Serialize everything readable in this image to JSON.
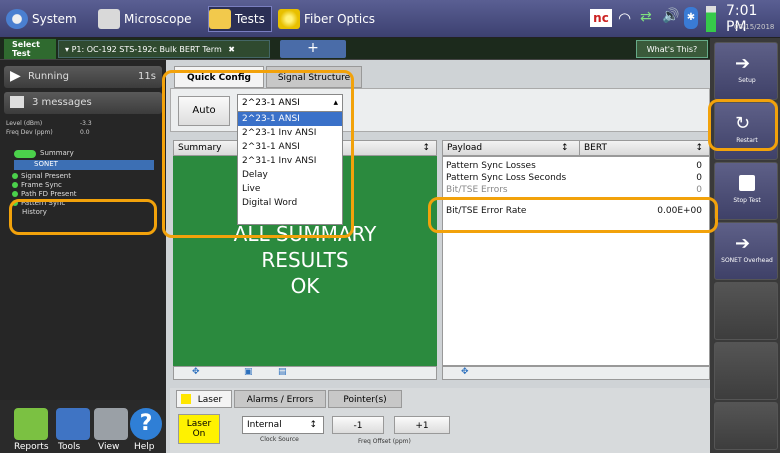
{
  "topbar": {
    "system": "System",
    "microscope": "Microscope",
    "tests": "Tests",
    "fiber_optics": "Fiber Optics",
    "nc_badge": "nc",
    "time": "7:01 PM",
    "date": "06/15/2018"
  },
  "testbar": {
    "select_test": "Select Test",
    "tab_name": "P1: OC-192 STS-192c Bulk BERT Term",
    "add_tab": "+",
    "whats_this": "What's This?"
  },
  "left": {
    "running": "Running",
    "elapsed": "11s",
    "messages": "3 messages",
    "level_label": "Level (dBm)",
    "level_value": "-3.3",
    "freq_label": "Freq Dev (ppm)",
    "freq_value": "0.0",
    "tree": {
      "summary": "Summary",
      "sonet": "SONET",
      "signal_present": "Signal Present",
      "frame_sync": "Frame Sync",
      "path_fd_present": "Path FD Present",
      "pattern_sync": "Pattern Sync",
      "history": "History"
    }
  },
  "bottom_nav": {
    "reports": "Reports",
    "tools": "Tools",
    "view": "View",
    "help": "Help"
  },
  "config": {
    "tab_quick": "Quick Config",
    "tab_signal": "Signal Structure",
    "auto": "Auto",
    "pattern_selected": "2^23-1 ANSI",
    "pattern_options": [
      "2^23-1 ANSI",
      "2^23-1 Inv ANSI",
      "2^31-1 ANSI",
      "2^31-1 Inv ANSI",
      "Delay",
      "Live",
      "Digital Word"
    ]
  },
  "summary": {
    "header": "Summary",
    "line1": "ALL SUMMARY",
    "line2": "RESULTS",
    "line3": "OK"
  },
  "results": {
    "header_left": "Payload",
    "header_right": "BERT",
    "rows": [
      {
        "label": "Pattern Sync Losses",
        "value": "0"
      },
      {
        "label": "Pattern Sync Loss Seconds",
        "value": "0"
      },
      {
        "label": "Bit/TSE Errors",
        "value": "0"
      },
      {
        "label": "Bit/TSE Error Rate",
        "value": "0.00E+00"
      }
    ]
  },
  "bottom": {
    "tab_laser": "Laser",
    "tab_alarms": "Alarms / Errors",
    "tab_pointers": "Pointer(s)",
    "laser_on": "Laser On",
    "clock_value": "Internal",
    "clock_label": "Clock Source",
    "minus": "-1",
    "plus": "+1",
    "freq_offset": "Freq Offset (ppm)"
  },
  "right": {
    "setup": "Setup",
    "restart": "Restart",
    "stop_test": "Stop Test",
    "sonet_overhead": "SONET Overhead"
  },
  "colors": {
    "accent_orange": "#f2a20b",
    "summary_green": "#2b8a3e",
    "selected_blue": "#3a71c9"
  }
}
